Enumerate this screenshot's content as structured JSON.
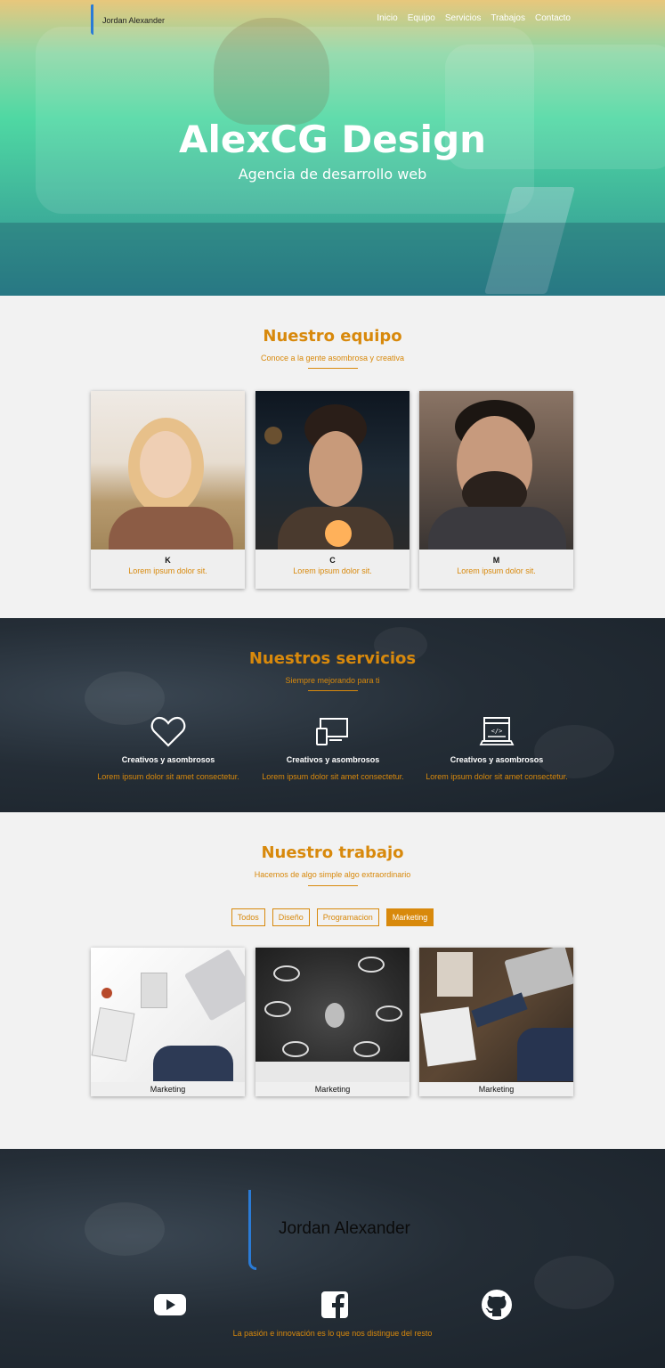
{
  "brand": {
    "name": "Jordan Alexander"
  },
  "nav": {
    "items": [
      "Inicio",
      "Equipo",
      "Servicios",
      "Trabajos",
      "Contacto"
    ]
  },
  "hero": {
    "title": "AlexCG Design",
    "subtitle": "Agencia de desarrollo web"
  },
  "team": {
    "title": "Nuestro equipo",
    "subtitle": "Conoce a la gente asombrosa y creativa",
    "members": [
      {
        "name": "K",
        "role": "Lorem ipsum dolor sit."
      },
      {
        "name": "C",
        "role": "Lorem ipsum dolor sit."
      },
      {
        "name": "M",
        "role": "Lorem ipsum dolor sit."
      }
    ]
  },
  "services": {
    "title": "Nuestros servicios",
    "subtitle": "Siempre mejorando para ti",
    "items": [
      {
        "icon": "heart-icon",
        "title": "Creativos y asombrosos",
        "desc": "Lorem ipsum dolor sit amet consectetur."
      },
      {
        "icon": "devices-icon",
        "title": "Creativos y asombrosos",
        "desc": "Lorem ipsum dolor sit amet consectetur."
      },
      {
        "icon": "code-window-icon",
        "title": "Creativos y asombrosos",
        "desc": "Lorem ipsum dolor sit amet consectetur."
      }
    ]
  },
  "work": {
    "title": "Nuestro trabajo",
    "subtitle": "Hacemos de algo simple algo extraordinario",
    "filters": [
      "Todos",
      "Diseño",
      "Programacion",
      "Marketing"
    ],
    "active_filter": "Marketing",
    "items": [
      {
        "caption": "Marketing"
      },
      {
        "caption": "Marketing"
      },
      {
        "caption": "Marketing"
      }
    ]
  },
  "footer": {
    "brand": "Jordan Alexander",
    "social": [
      "youtube-icon",
      "facebook-icon",
      "github-icon"
    ],
    "tagline": "La pasión e innovación es lo que nos distingue del resto"
  },
  "colors": {
    "accent": "#d8890c",
    "brand_blue": "#2a7bd6",
    "dark": "#1f2830"
  }
}
